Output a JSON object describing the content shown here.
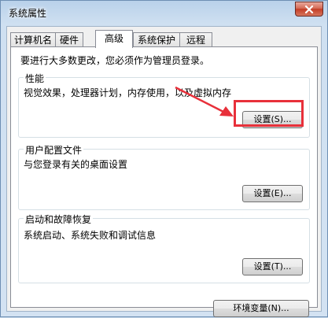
{
  "window": {
    "title": "系统属性"
  },
  "tabs": [
    {
      "label": "计算机名",
      "active": false
    },
    {
      "label": "硬件",
      "active": false
    },
    {
      "label": "高级",
      "active": true
    },
    {
      "label": "系统保护",
      "active": false
    },
    {
      "label": "远程",
      "active": false
    }
  ],
  "notice": "要进行大多数更改，您必须作为管理员登录。",
  "performance": {
    "title": "性能",
    "description": "视觉效果，处理器计划，内存使用，以及虚拟内存",
    "button": "设置(S)..."
  },
  "profiles": {
    "title": "用户配置文件",
    "description": "与您登录有关的桌面设置",
    "button": "设置(E)..."
  },
  "startup": {
    "title": "启动和故障恢复",
    "description": "系统启动、系统失败和调试信息",
    "button": "设置(T)..."
  },
  "env_button": "环境变量(N)...",
  "colors": {
    "highlight": "#e8303a",
    "arrow": "#e8303a"
  }
}
